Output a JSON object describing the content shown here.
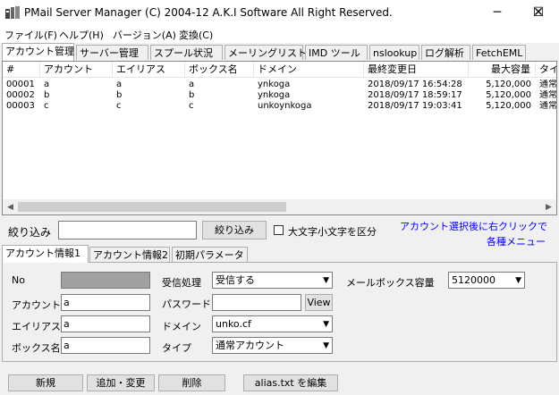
{
  "window": {
    "title": "PMail Server Manager (C) 2004-12 A.K.I Software All Right Reserved.",
    "icon": "app-icon",
    "minimize": "─",
    "maximize": "☐",
    "close": "✕"
  },
  "menu": [
    "ファイル(F)",
    "ヘルプ(H)",
    "バージョン(A)",
    "変換(C)"
  ],
  "tabs": [
    "アカウント管理",
    "サーバー管理",
    "スプール状況",
    "メーリングリスト",
    "IMD ツール",
    "nslookup",
    "ログ解析",
    "FetchEML"
  ],
  "table": {
    "headers": [
      "#",
      "アカウント",
      "エイリアス",
      "ボックス名",
      "ドメイン",
      "最終変更日",
      "最大容量",
      "タイ"
    ],
    "rows": [
      [
        "00001",
        "a",
        "a",
        "a",
        "ynkoga",
        "2018/09/17 16:54:28",
        "5,120,000",
        "通常"
      ],
      [
        "00002",
        "b",
        "b",
        "b",
        "ynkoga",
        "2018/09/17 18:59:17",
        "5,120,000",
        "通常"
      ],
      [
        "00003",
        "c",
        "c",
        "c",
        "unkoynkoga",
        "2018/09/17 19:03:41",
        "5,120,000",
        "通常"
      ]
    ]
  },
  "filter": {
    "label": "絞り込み",
    "value": "",
    "button": "絞り込み",
    "case_label": "大文字小文字を区分",
    "hint_line1": "アカウント選択後に右クリックで",
    "hint_line2": "各種メニュー"
  },
  "subtabs": [
    "アカウント情報1",
    "アカウント情報2",
    "初期パラメータ"
  ],
  "form": {
    "no_label": "No",
    "no_value": "",
    "account_label": "アカウント",
    "account_value": "a",
    "alias_label": "エイリアス",
    "alias_value": "a",
    "box_label": "ボックス名",
    "box_value": "a",
    "receive_label": "受信処理",
    "receive_value": "受信する",
    "password_label": "パスワード",
    "password_value": "",
    "view_button": "View",
    "domain_label": "ドメイン",
    "domain_value": "unko.cf",
    "type_label": "タイプ",
    "type_value": "通常アカウント",
    "capacity_label": "メールボックス容量",
    "capacity_value": "5120000"
  },
  "buttons": {
    "new": "新規",
    "add": "追加・変更",
    "delete": "削除",
    "edit_alias": "alias.txt を編集"
  },
  "colors": {
    "hint": "#0000ff",
    "no_field": "#a0a0a0"
  }
}
